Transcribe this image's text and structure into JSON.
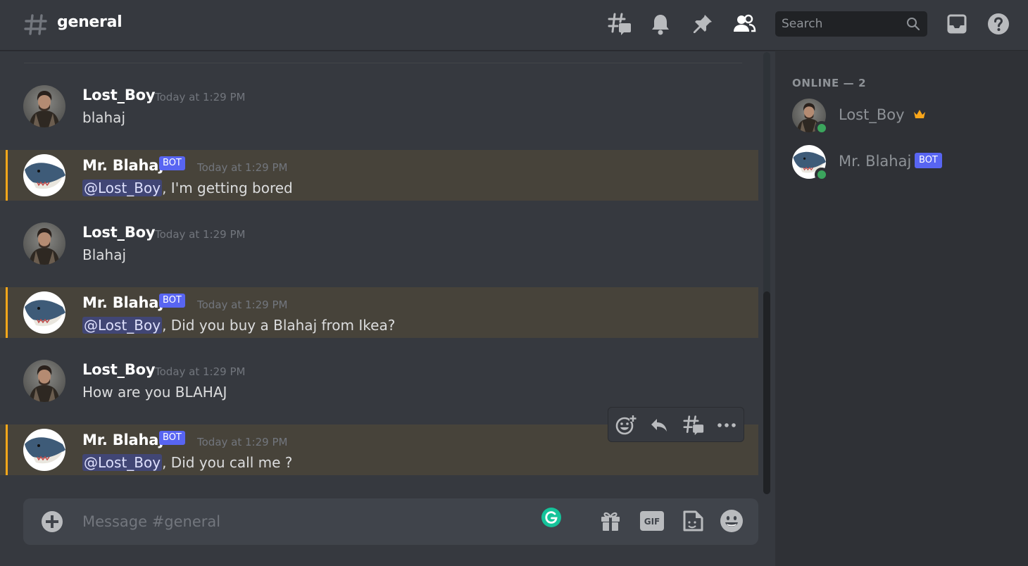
{
  "header": {
    "channel_name": "general",
    "search_placeholder": "Search",
    "icons": [
      "threads-icon",
      "notification-bell-icon",
      "pin-icon",
      "member-list-icon",
      "search-icon",
      "inbox-icon",
      "help-icon"
    ]
  },
  "colors": {
    "background": "#36393f",
    "sidebar": "#2f3136",
    "mention_highlight": "#47433a",
    "mention_bar": "#faa81a",
    "bot_tag": "#5865f2",
    "online": "#3ba55d"
  },
  "messages": [
    {
      "author": "Lost_Boy",
      "bot": false,
      "timestamp": "Today at 1:29 PM",
      "mention": "",
      "content": "blahaj"
    },
    {
      "author": "Mr. Blahaj",
      "bot": true,
      "bot_label": "BOT",
      "timestamp": "Today at 1:29 PM",
      "mention": "@Lost_Boy",
      "content": ", I'm getting bored"
    },
    {
      "author": "Lost_Boy",
      "bot": false,
      "timestamp": "Today at 1:29 PM",
      "mention": "",
      "content": "Blahaj"
    },
    {
      "author": "Mr. Blahaj",
      "bot": true,
      "bot_label": "BOT",
      "timestamp": "Today at 1:29 PM",
      "mention": "@Lost_Boy",
      "content": ", Did you buy a Blahaj from Ikea?"
    },
    {
      "author": "Lost_Boy",
      "bot": false,
      "timestamp": "Today at 1:29 PM",
      "mention": "",
      "content": "How are you BLAHAJ"
    },
    {
      "author": "Mr. Blahaj",
      "bot": true,
      "bot_label": "BOT",
      "timestamp": "Today at 1:29 PM",
      "mention": "@Lost_Boy",
      "content": ", Did you call me ?"
    }
  ],
  "hover_toolbar": {
    "icons": [
      "add-reaction-icon",
      "reply-icon",
      "create-thread-icon",
      "more-icon"
    ]
  },
  "composer": {
    "placeholder": "Message #general",
    "buttons": [
      "upload-plus-icon",
      "gift-icon",
      "gif-icon",
      "sticker-icon",
      "emoji-icon"
    ],
    "gif_label": "GIF"
  },
  "members": {
    "header": "ONLINE — 2",
    "list": [
      {
        "name": "Lost_Boy",
        "status": "online",
        "owner": true
      },
      {
        "name": "Mr. Blahaj",
        "status": "online",
        "bot": true,
        "bot_label": "BOT"
      }
    ]
  }
}
